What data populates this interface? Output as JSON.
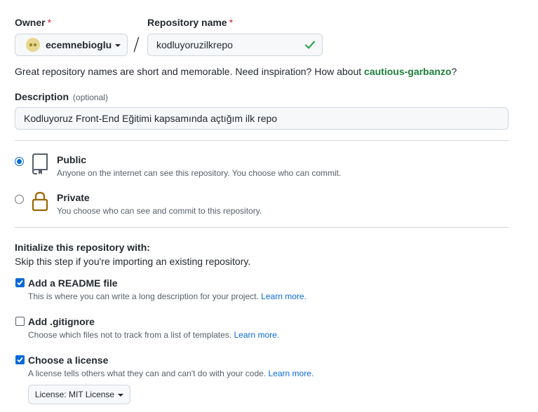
{
  "owner": {
    "label": "Owner",
    "required_mark": "*",
    "username": "ecemnebioglu"
  },
  "separator": "/",
  "repo": {
    "label": "Repository name",
    "required_mark": "*",
    "value": "kodluyoruzilkrepo"
  },
  "hint": {
    "text": "Great repository names are short and memorable. Need inspiration? How about ",
    "suggestion": "cautious-garbanzo",
    "end": "?"
  },
  "description": {
    "label": "Description",
    "optional": "(optional)",
    "value": "Kodluyoruz Front-End Eğitimi kapsamında açtığım ilk repo"
  },
  "visibility": {
    "public": {
      "title": "Public",
      "desc": "Anyone on the internet can see this repository. You choose who can commit.",
      "selected": true
    },
    "private": {
      "title": "Private",
      "desc": "You choose who can see and commit to this repository.",
      "selected": false
    }
  },
  "init": {
    "title": "Initialize this repository with:",
    "subtitle": "Skip this step if you're importing an existing repository.",
    "readme": {
      "label": "Add a README file",
      "desc": "This is where you can write a long description for your project.",
      "link": "Learn more.",
      "checked": true
    },
    "gitignore": {
      "label": "Add .gitignore",
      "desc": "Choose which files not to track from a list of templates.",
      "link": "Learn more.",
      "checked": false
    },
    "license": {
      "label": "Choose a license",
      "desc": "A license tells others what they can and can't do with your code.",
      "link": "Learn more.",
      "checked": true
    }
  },
  "license_button": {
    "prefix": "License:",
    "value": "MIT License"
  },
  "colors": {
    "accent": "#0969da",
    "success": "#1a7f37",
    "danger": "#cf222e",
    "border": "#d0d7de"
  }
}
